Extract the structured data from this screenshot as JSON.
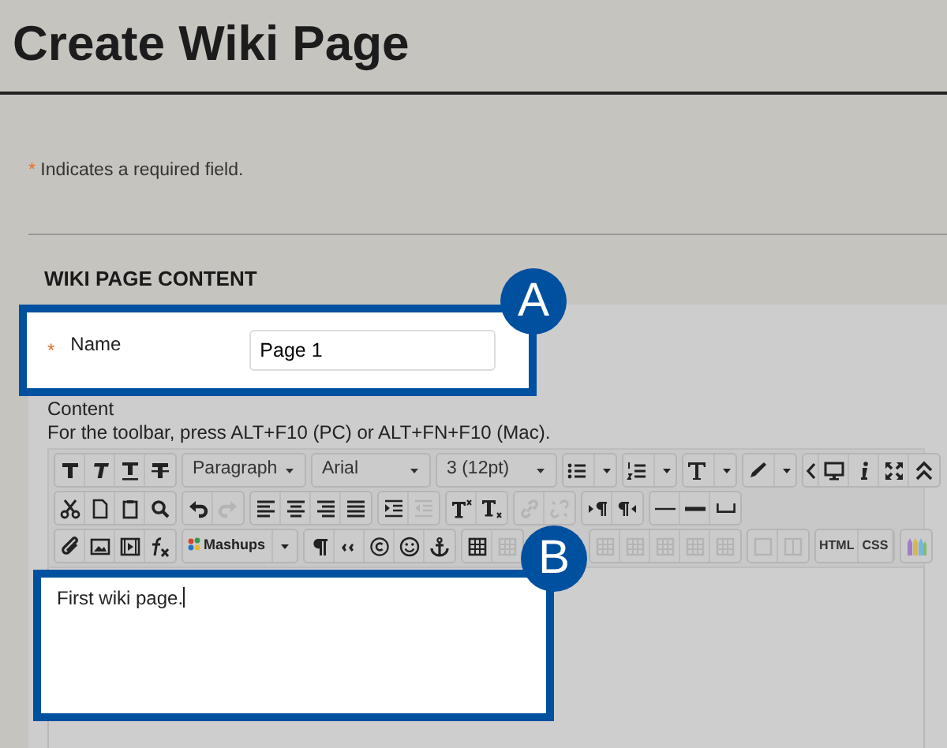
{
  "title": "Create Wiki Page",
  "required_note": {
    "mark": "*",
    "text": "Indicates a required field."
  },
  "section_title": "WIKI PAGE CONTENT",
  "name_field": {
    "required_mark": "*",
    "label": "Name",
    "value": "Page 1",
    "callout": "A"
  },
  "content": {
    "label": "Content",
    "hint": "For the toolbar, press ALT+F10 (PC) or ALT+FN+F10 (Mac).",
    "toolbar": [
      [
        [
          {
            "kind": "button",
            "disabled": false
          },
          {
            "kind": "button",
            "disabled": false
          },
          {
            "kind": "button",
            "disabled": false
          },
          {
            "kind": "button",
            "disabled": false
          }
        ],
        [
          {
            "kind": "select",
            "label": "Paragraph"
          }
        ],
        [
          {
            "kind": "select",
            "label": "Arial"
          }
        ],
        [
          {
            "kind": "select",
            "label": "3 (12pt)"
          }
        ],
        [
          {
            "kind": "split"
          }
        ],
        [
          {
            "kind": "split"
          }
        ],
        [
          {
            "kind": "split"
          }
        ],
        [
          {
            "kind": "split"
          }
        ],
        [
          {
            "kind": "button",
            "disabled": false
          },
          {
            "kind": "button",
            "disabled": false
          },
          {
            "kind": "button",
            "disabled": false
          },
          {
            "kind": "button",
            "disabled": false
          },
          {
            "kind": "button",
            "disabled": false
          }
        ]
      ],
      [
        [
          {
            "kind": "button",
            "disabled": false
          },
          {
            "kind": "button",
            "disabled": false
          },
          {
            "kind": "button",
            "disabled": false
          },
          {
            "kind": "button",
            "disabled": false
          }
        ],
        [
          {
            "kind": "button",
            "disabled": false
          },
          {
            "kind": "button",
            "disabled": true
          }
        ],
        [
          {
            "kind": "button",
            "disabled": false
          },
          {
            "kind": "button",
            "disabled": false
          },
          {
            "kind": "button",
            "disabled": false
          },
          {
            "kind": "button",
            "disabled": false
          }
        ],
        [
          {
            "kind": "button",
            "disabled": false
          },
          {
            "kind": "button",
            "disabled": true
          }
        ],
        [
          {
            "kind": "button",
            "disabled": false
          },
          {
            "kind": "button",
            "disabled": false
          }
        ],
        [
          {
            "kind": "button",
            "disabled": true
          },
          {
            "kind": "button",
            "disabled": true
          }
        ],
        [
          {
            "kind": "button",
            "disabled": false
          },
          {
            "kind": "button",
            "disabled": false
          }
        ],
        [
          {
            "kind": "button",
            "disabled": false
          },
          {
            "kind": "button",
            "disabled": false
          },
          {
            "kind": "button",
            "disabled": false
          }
        ]
      ],
      [
        [
          {
            "kind": "button",
            "disabled": false
          },
          {
            "kind": "button",
            "disabled": false
          },
          {
            "kind": "button",
            "disabled": false
          },
          {
            "kind": "button",
            "disabled": false
          }
        ],
        [
          {
            "kind": "split",
            "label": "Mashups"
          }
        ],
        [
          {
            "kind": "button",
            "disabled": false
          },
          {
            "kind": "button",
            "disabled": false
          },
          {
            "kind": "button",
            "disabled": false
          },
          {
            "kind": "button",
            "disabled": false
          },
          {
            "kind": "button",
            "disabled": false
          }
        ],
        [
          {
            "kind": "button",
            "disabled": false
          },
          {
            "kind": "button",
            "disabled": true
          }
        ],
        [
          {
            "kind": "button",
            "disabled": true
          },
          {
            "kind": "button",
            "disabled": true
          },
          {
            "kind": "button",
            "disabled": true
          },
          {
            "kind": "button",
            "disabled": true
          },
          {
            "kind": "button",
            "disabled": true
          }
        ],
        [
          {
            "kind": "button",
            "disabled": true
          },
          {
            "kind": "button",
            "disabled": true
          }
        ],
        [
          {
            "kind": "text",
            "label": "HTML"
          },
          {
            "kind": "text",
            "label": "CSS"
          }
        ],
        [
          {
            "kind": "button",
            "disabled": false
          }
        ]
      ]
    ],
    "editor_text": "First wiki page.",
    "callout": "B"
  }
}
